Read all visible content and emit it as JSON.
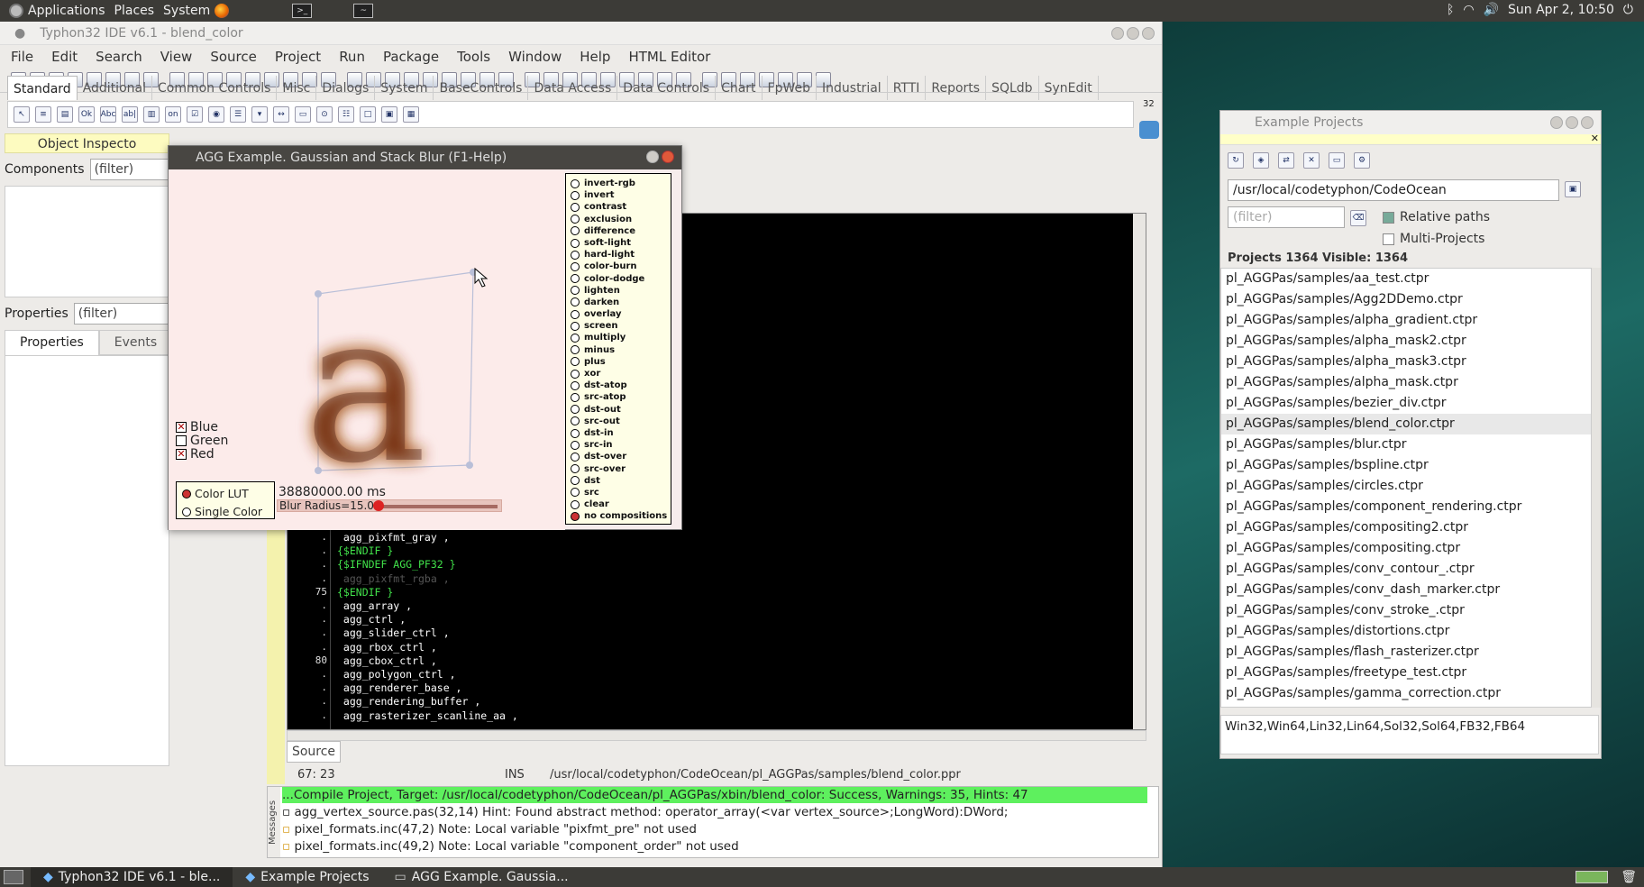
{
  "top_panel": {
    "menus": [
      "Applications",
      "Places",
      "System"
    ],
    "clock": "Sun Apr 2, 10:50"
  },
  "ide": {
    "title": "Typhon32 IDE v6.1 - blend_color",
    "menu": [
      "File",
      "Edit",
      "Search",
      "View",
      "Source",
      "Project",
      "Run",
      "Package",
      "Tools",
      "Window",
      "Help",
      "HTML Editor"
    ],
    "palette_tabs": [
      "Standard",
      "Additional",
      "Common Controls",
      "Misc",
      "Dialogs",
      "System",
      "BaseControls",
      "Data Access",
      "Data Controls",
      "Chart",
      "FpWeb",
      "Industrial",
      "RTTI",
      "Reports",
      "SQLdb",
      "SynEdit"
    ],
    "palette_counter": "32",
    "palette_icon_text": [
      "Ok",
      "Abc",
      "ab|",
      "on"
    ],
    "object_inspector": {
      "title": "Object Inspecto",
      "components_label": "Components",
      "properties_label": "Properties",
      "filter_placeholder": "(filter)",
      "tabs": [
        "Properties",
        "Events"
      ]
    },
    "code_lines": [
      {
        "num": ".",
        "text": " agg_pixfmt_gray ,",
        "cls": "cw"
      },
      {
        "num": ".",
        "text": "{$ENDIF }",
        "cls": "cg"
      },
      {
        "num": ".",
        "text": "{$IFNDEF AGG_PF32 }",
        "cls": "cg"
      },
      {
        "num": ".",
        "text": " agg_pixfmt_rgba ,",
        "cls": "cd"
      },
      {
        "num": "75",
        "text": "{$ENDIF }",
        "cls": "cg"
      },
      {
        "num": ".",
        "text": " agg_array ,",
        "cls": "cw"
      },
      {
        "num": ".",
        "text": " agg_ctrl ,",
        "cls": "cw"
      },
      {
        "num": ".",
        "text": " agg_slider_ctrl ,",
        "cls": "cw"
      },
      {
        "num": ".",
        "text": " agg_rbox_ctrl ,",
        "cls": "cw"
      },
      {
        "num": "80",
        "text": " agg_cbox_ctrl ,",
        "cls": "cw"
      },
      {
        "num": ".",
        "text": " agg_polygon_ctrl ,",
        "cls": "cw"
      },
      {
        "num": ".",
        "text": " agg_renderer_base ,",
        "cls": "cw"
      },
      {
        "num": ".",
        "text": " agg_rendering_buffer ,",
        "cls": "cw"
      },
      {
        "num": ".",
        "text": " agg_rasterizer_scanline_aa ,",
        "cls": "cw"
      }
    ],
    "source_tab": "Source",
    "status": {
      "pos": "67: 23",
      "mode": "INS",
      "file": "/usr/local/codetyphon/CodeOcean/pl_AGGPas/samples/blend_color.ppr"
    },
    "messages_label": "Messages",
    "messages": [
      "...Compile Project, Target: /usr/local/codetyphon/CodeOcean/pl_AGGPas/xbin/blend_color: Success, Warnings: 35, Hints: 47",
      "agg_vertex_source.pas(32,14) Hint: Found abstract method: operator_array(<var vertex_source>;LongWord):DWord;",
      "pixel_formats.inc(47,2) Note: Local variable \"pixfmt_pre\" not used",
      "pixel_formats.inc(49,2) Note: Local variable \"component_order\" not used"
    ]
  },
  "agg": {
    "title": "AGG Example. Gaussian and Stack Blur (F1-Help)",
    "glyph": "a",
    "blend_modes": [
      "invert-rgb",
      "invert",
      "contrast",
      "exclusion",
      "difference",
      "soft-light",
      "hard-light",
      "color-burn",
      "color-dodge",
      "lighten",
      "darken",
      "overlay",
      "screen",
      "multiply",
      "minus",
      "plus",
      "xor",
      "dst-atop",
      "src-atop",
      "dst-out",
      "src-out",
      "dst-in",
      "src-in",
      "dst-over",
      "src-over",
      "dst",
      "src",
      "clear",
      "no compositions"
    ],
    "selected_mode": "no compositions",
    "channels": [
      {
        "label": "Blue",
        "checked": true
      },
      {
        "label": "Green",
        "checked": false
      },
      {
        "label": "Red",
        "checked": true
      }
    ],
    "lut_options": [
      "Color LUT",
      "Single Color"
    ],
    "selected_lut": "Color LUT",
    "time": "38880000.00  ms",
    "blur_label": "Blur Radius=15.00",
    "blur_fraction": 0.15
  },
  "example_projects": {
    "title": "Example Projects",
    "path": "/usr/local/codetyphon/CodeOcean",
    "filter_placeholder": "(filter)",
    "relative_paths": "Relative paths",
    "multi_projects": "Multi-Projects",
    "count": "Projects 1364  Visible: 1364",
    "items": [
      "pl_AGGPas/samples/aa_test.ctpr",
      "pl_AGGPas/samples/Agg2DDemo.ctpr",
      "pl_AGGPas/samples/alpha_gradient.ctpr",
      "pl_AGGPas/samples/alpha_mask2.ctpr",
      "pl_AGGPas/samples/alpha_mask3.ctpr",
      "pl_AGGPas/samples/alpha_mask.ctpr",
      "pl_AGGPas/samples/bezier_div.ctpr",
      "pl_AGGPas/samples/blend_color.ctpr",
      "pl_AGGPas/samples/blur.ctpr",
      "pl_AGGPas/samples/bspline.ctpr",
      "pl_AGGPas/samples/circles.ctpr",
      "pl_AGGPas/samples/component_rendering.ctpr",
      "pl_AGGPas/samples/compositing2.ctpr",
      "pl_AGGPas/samples/compositing.ctpr",
      "pl_AGGPas/samples/conv_contour_.ctpr",
      "pl_AGGPas/samples/conv_dash_marker.ctpr",
      "pl_AGGPas/samples/conv_stroke_.ctpr",
      "pl_AGGPas/samples/distortions.ctpr",
      "pl_AGGPas/samples/flash_rasterizer.ctpr",
      "pl_AGGPas/samples/freetype_test.ctpr",
      "pl_AGGPas/samples/gamma_correction.ctpr"
    ],
    "selected": "pl_AGGPas/samples/blend_color.ctpr",
    "targets": "Win32,Win64,Lin32,Lin64,Sol32,Sol64,FB32,FB64"
  },
  "taskbar": [
    "Typhon32 IDE v6.1 - ble...",
    "Example Projects",
    "AGG Example. Gaussia..."
  ]
}
